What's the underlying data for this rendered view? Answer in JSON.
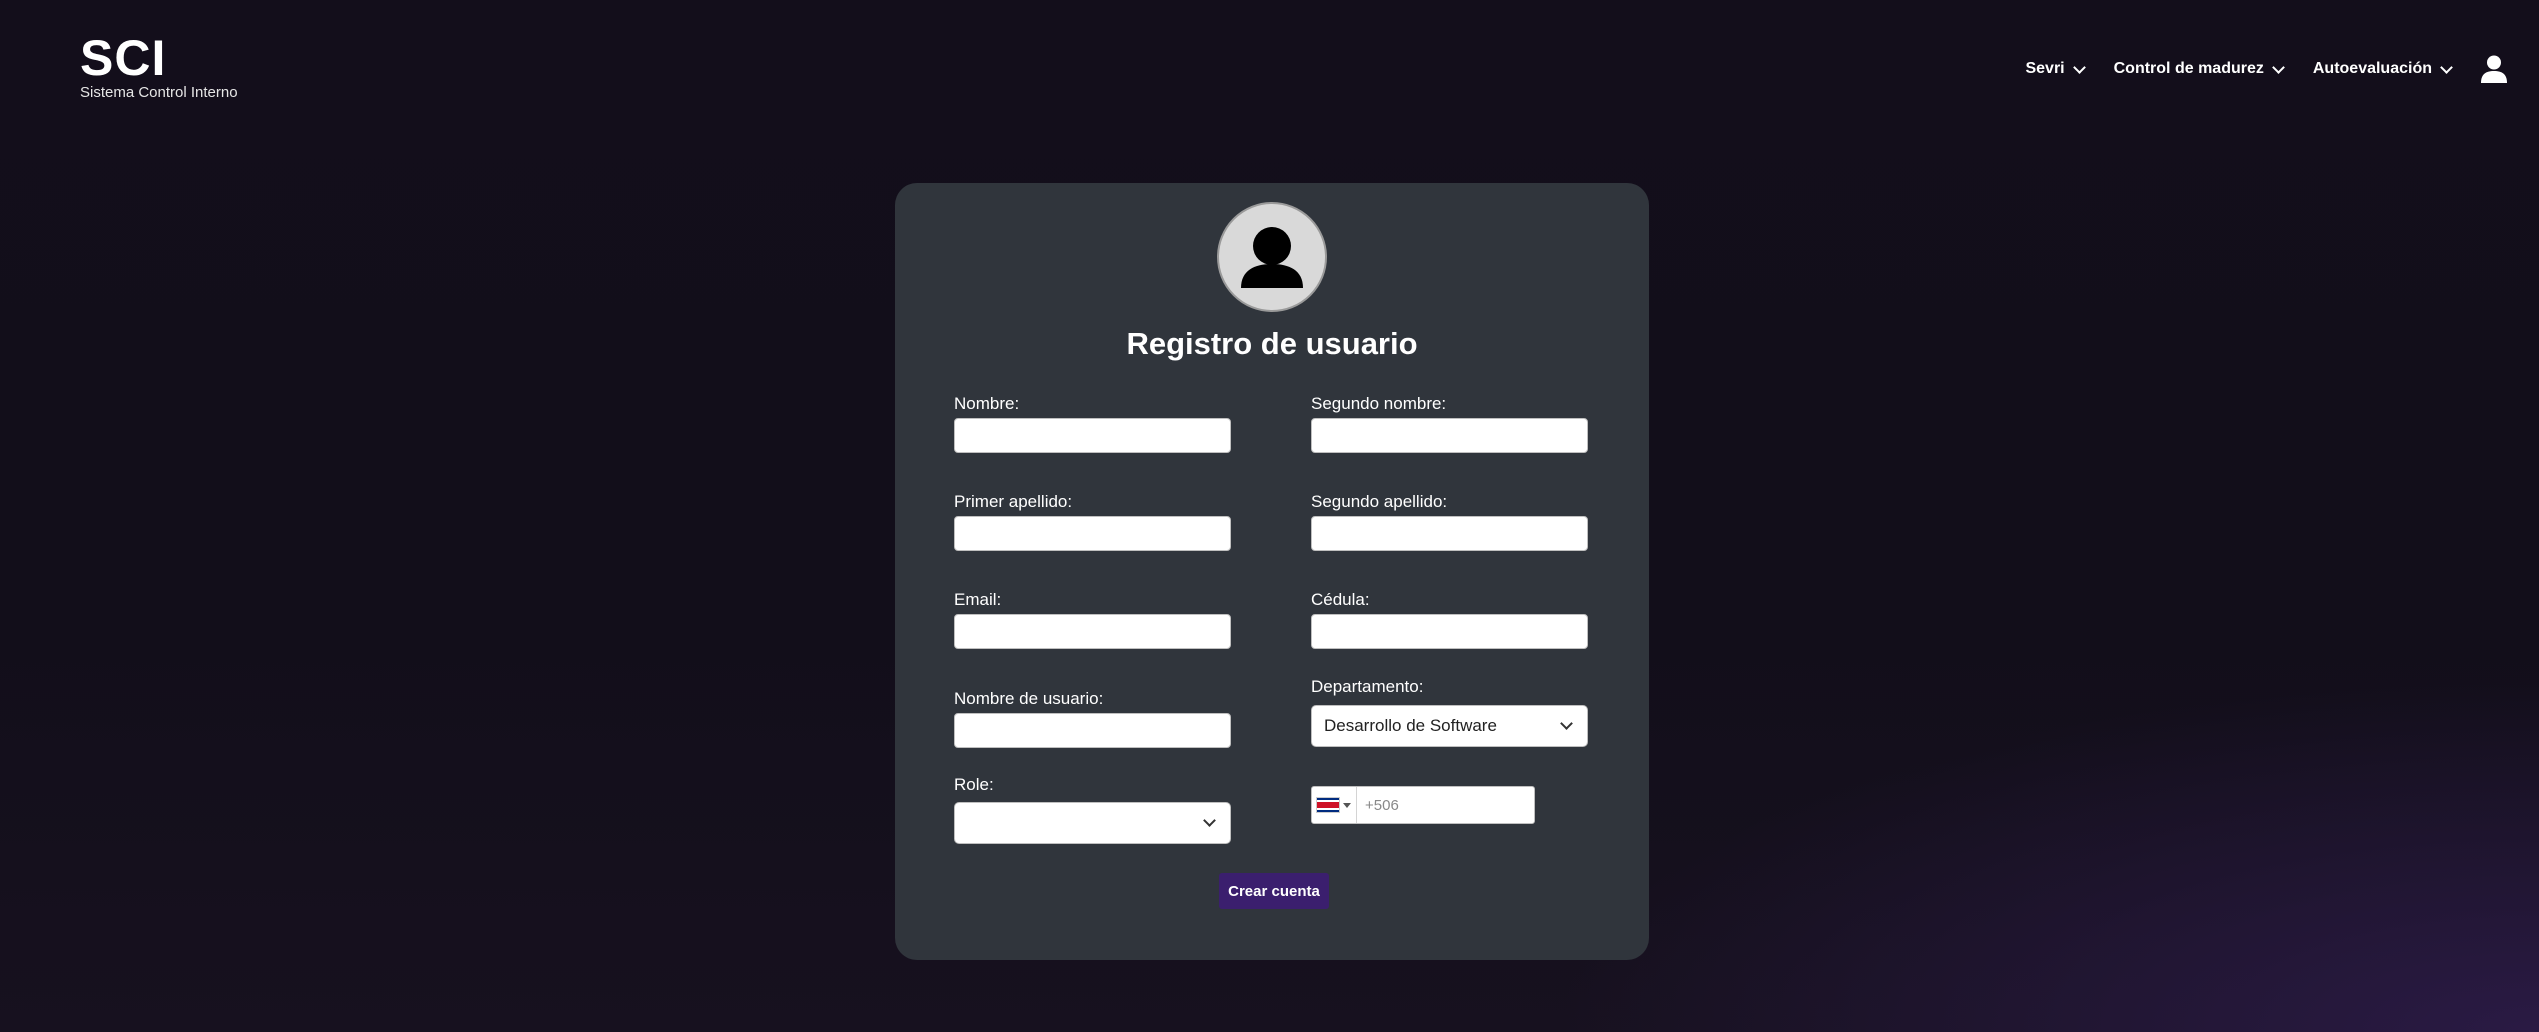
{
  "brand": {
    "title": "SCI",
    "subtitle": "Sistema Control Interno"
  },
  "nav": {
    "items": [
      {
        "label": "Sevri"
      },
      {
        "label": "Control de madurez"
      },
      {
        "label": "Autoevaluación"
      }
    ],
    "user_icon": "user-icon"
  },
  "form": {
    "title": "Registro de usuario",
    "avatar_icon": "user-avatar-icon",
    "fields": {
      "nombre": {
        "label": "Nombre:",
        "value": ""
      },
      "segundo_nombre": {
        "label": "Segundo nombre:",
        "value": ""
      },
      "primer_apellido": {
        "label": "Primer apellido:",
        "value": ""
      },
      "segundo_apellido": {
        "label": "Segundo apellido:",
        "value": ""
      },
      "email": {
        "label": "Email:",
        "value": ""
      },
      "cedula": {
        "label": "Cédula:",
        "value": ""
      },
      "nombre_usuario": {
        "label": "Nombre de usuario:",
        "value": ""
      },
      "departamento": {
        "label": "Departamento:",
        "value": "Desarrollo de Software"
      },
      "role": {
        "label": "Role:",
        "value": ""
      },
      "telefono": {
        "country_flag": "costa-rica-flag",
        "placeholder": "+506"
      }
    },
    "submit_label": "Crear cuenta"
  },
  "colors": {
    "background": "#130e1b",
    "card": "#30353c",
    "button": "#3b1f6e"
  }
}
